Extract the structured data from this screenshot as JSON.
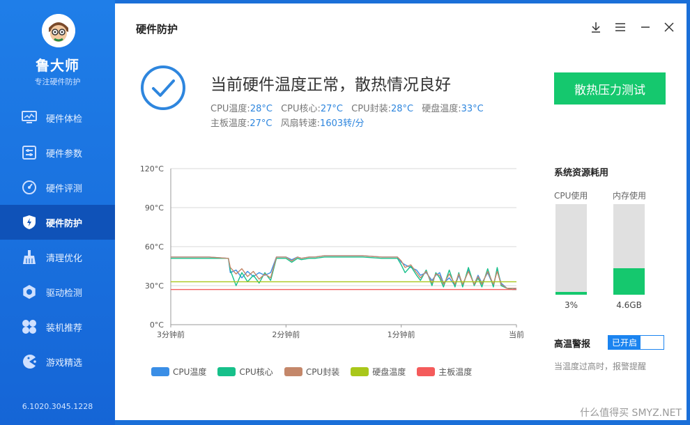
{
  "sidebar": {
    "brand": "鲁大师",
    "slogan": "专注硬件防护",
    "version": "6.1020.3045.1228",
    "items": [
      {
        "label": "硬件体检",
        "icon": "monitor-icon"
      },
      {
        "label": "硬件参数",
        "icon": "sliders-icon"
      },
      {
        "label": "硬件评测",
        "icon": "gauge-icon"
      },
      {
        "label": "硬件防护",
        "icon": "shield-icon",
        "active": true
      },
      {
        "label": "清理优化",
        "icon": "broom-icon"
      },
      {
        "label": "驱动检测",
        "icon": "gear-icon"
      },
      {
        "label": "装机推荐",
        "icon": "clover-icon"
      },
      {
        "label": "游戏精选",
        "icon": "pacman-icon"
      }
    ]
  },
  "header": {
    "title": "硬件防护"
  },
  "status": {
    "title": "当前硬件温度正常，散热情况良好",
    "line1": [
      {
        "label": "CPU温度:",
        "value": "28°C"
      },
      {
        "label": "CPU核心:",
        "value": "27°C"
      },
      {
        "label": "CPU封装:",
        "value": "28°C"
      },
      {
        "label": "硬盘温度:",
        "value": "33°C"
      }
    ],
    "line2": [
      {
        "label": "主板温度:",
        "value": "27°C"
      },
      {
        "label": "风扇转速:",
        "value": "1603转/分"
      }
    ]
  },
  "stress_button": "散热压力测试",
  "resources": {
    "title": "系统资源耗用",
    "cpu": {
      "label": "CPU使用",
      "value": "3%",
      "fraction": 0.03
    },
    "mem": {
      "label": "内存使用",
      "value": "4.6GB",
      "fraction": 0.29
    }
  },
  "alarm": {
    "title": "高温警报",
    "toggle_label": "已开启",
    "desc": "当温度过高时，报警提醒"
  },
  "watermark": "什么值得买 SMYZ.NET",
  "colors": {
    "accent": "#1b84f0",
    "green": "#15c86e",
    "cpu_temp": "#3a8ee6",
    "cpu_core": "#17c08a",
    "cpu_pkg": "#c4876a",
    "disk": "#a9c71a",
    "board": "#f45b5b"
  },
  "chart_data": {
    "type": "line",
    "ylim": [
      0,
      120
    ],
    "y_ticks": [
      "0°C",
      "30°C",
      "60°C",
      "90°C",
      "120°C"
    ],
    "x_ticks": [
      "3分钟前",
      "2分钟前",
      "1分钟前",
      "当前"
    ],
    "x_range": [
      -180,
      0
    ],
    "legend": [
      "CPU温度",
      "CPU核心",
      "CPU封装",
      "硬盘温度",
      "主板温度"
    ],
    "series": [
      {
        "name": "CPU温度",
        "color": "#3a8ee6",
        "x": [
          -180,
          -160,
          -150,
          -149,
          -146,
          -143,
          -140,
          -137,
          -134,
          -131,
          -128,
          -125,
          -120,
          -117,
          -114,
          -112,
          -108,
          -105,
          -100,
          -90,
          -80,
          -70,
          -62,
          -60,
          -58,
          -55,
          -52,
          -50,
          -47,
          -44,
          -42,
          -40,
          -38,
          -35,
          -32,
          -30,
          -28,
          -25,
          -22,
          -20,
          -18,
          -15,
          -12,
          -10,
          -8,
          -5,
          -2,
          0
        ],
        "values": [
          52,
          52,
          51,
          40,
          42,
          36,
          41,
          37,
          40,
          38,
          40,
          52,
          52,
          50,
          52,
          51,
          52,
          52,
          53,
          53,
          53,
          52,
          52,
          48,
          46,
          44,
          42,
          38,
          40,
          34,
          38,
          40,
          32,
          36,
          30,
          38,
          30,
          42,
          31,
          38,
          32,
          40,
          30,
          42,
          32,
          28,
          28,
          27
        ]
      },
      {
        "name": "CPU核心",
        "color": "#17c08a",
        "x": [
          -180,
          -160,
          -150,
          -149,
          -146,
          -143,
          -140,
          -137,
          -134,
          -131,
          -128,
          -125,
          -120,
          -117,
          -114,
          -112,
          -108,
          -105,
          -100,
          -90,
          -80,
          -70,
          -62,
          -60,
          -58,
          -55,
          -52,
          -50,
          -47,
          -44,
          -42,
          -40,
          -38,
          -35,
          -32,
          -30,
          -28,
          -25,
          -22,
          -20,
          -18,
          -15,
          -12,
          -10,
          -8,
          -5,
          -2,
          0
        ],
        "values": [
          51,
          51,
          51,
          42,
          30,
          40,
          33,
          38,
          32,
          40,
          34,
          51,
          51,
          48,
          51,
          50,
          51,
          51,
          52,
          52,
          52,
          51,
          51,
          46,
          40,
          45,
          38,
          34,
          42,
          30,
          40,
          36,
          29,
          42,
          29,
          40,
          29,
          44,
          30,
          36,
          29,
          43,
          29,
          44,
          30,
          28,
          27,
          27
        ]
      },
      {
        "name": "CPU封装",
        "color": "#c4876a",
        "x": [
          -180,
          -160,
          -150,
          -149,
          -146,
          -143,
          -140,
          -137,
          -134,
          -131,
          -128,
          -125,
          -120,
          -117,
          -114,
          -112,
          -108,
          -105,
          -100,
          -90,
          -80,
          -70,
          -62,
          -60,
          -58,
          -55,
          -52,
          -50,
          -47,
          -44,
          -42,
          -40,
          -38,
          -35,
          -32,
          -30,
          -28,
          -25,
          -22,
          -20,
          -18,
          -15,
          -12,
          -10,
          -8,
          -5,
          -2,
          0
        ],
        "values": [
          52,
          52,
          51,
          44,
          39,
          43,
          37,
          41,
          35,
          39,
          36,
          52,
          52,
          49,
          52,
          51,
          52,
          52,
          53,
          53,
          53,
          52,
          52,
          49,
          44,
          46,
          40,
          36,
          41,
          32,
          39,
          38,
          31,
          39,
          31,
          39,
          31,
          41,
          31,
          37,
          31,
          41,
          31,
          41,
          31,
          28,
          28,
          28
        ]
      },
      {
        "name": "硬盘温度",
        "color": "#a9c71a",
        "x": [
          -180,
          0
        ],
        "values": [
          33,
          33
        ]
      },
      {
        "name": "主板温度",
        "color": "#f45b5b",
        "x": [
          -180,
          0
        ],
        "values": [
          27,
          27
        ]
      }
    ]
  }
}
